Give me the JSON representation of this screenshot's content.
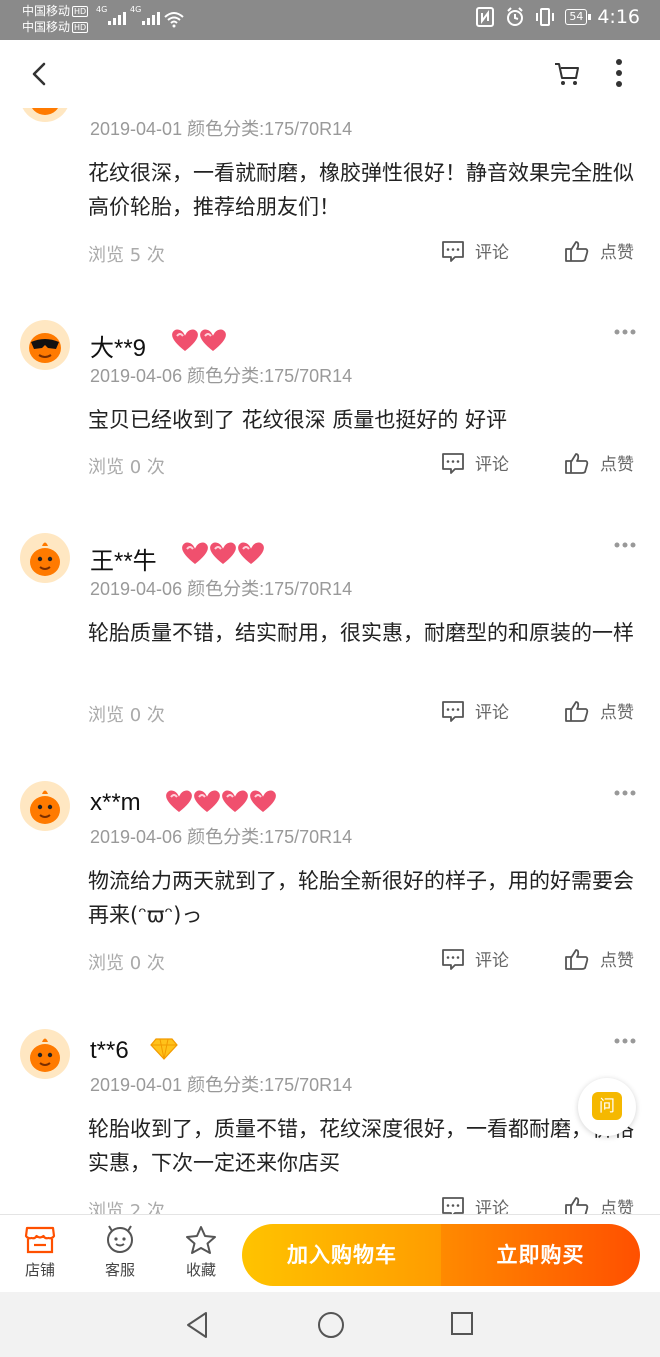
{
  "status_bar": {
    "carrier_1": "中国移动",
    "carrier_2": "中国移动",
    "hd": "HD",
    "network": "4G",
    "battery": "54",
    "time": "4:16"
  },
  "nav": {
    "back_icon": "chevron-left-icon",
    "cart_icon": "cart-icon",
    "more_icon": "more-vertical-icon"
  },
  "reviews": [
    {
      "user": "",
      "date": "2019-04-01",
      "sku": "颜色分类:175/70R14",
      "content": "花纹很深，一看就耐磨，橡胶弹性很好！静音效果完全胜似高价轮胎，推荐给朋友们！",
      "views": "浏览 5 次",
      "comment_label": "评论",
      "like_label": "点赞"
    },
    {
      "user": "大**9",
      "hearts": 2,
      "date": "2019-04-06",
      "sku": "颜色分类:175/70R14",
      "content": "宝贝已经收到了  花纹很深 质量也挺好的 好评",
      "views": "浏览 0 次",
      "comment_label": "评论",
      "like_label": "点赞"
    },
    {
      "user": "王**牛",
      "hearts": 3,
      "date": "2019-04-06",
      "sku": "颜色分类:175/70R14",
      "content": "轮胎质量不错，结实耐用，很实惠，耐磨型的和原装的一样",
      "views": "浏览 0 次",
      "comment_label": "评论",
      "like_label": "点赞"
    },
    {
      "user": "x**m",
      "hearts": 4,
      "date": "2019-04-06",
      "sku": "颜色分类:175/70R14",
      "content": "物流给力两天就到了，轮胎全新很好的样子，用的好需要会再来(ᵔϖᵔ)っ",
      "views": "浏览 0 次",
      "comment_label": "评论",
      "like_label": "点赞"
    },
    {
      "user": "t**6",
      "badge": "diamond",
      "date": "2019-04-01",
      "sku": "颜色分类:175/70R14",
      "content": "轮胎收到了，质量不错，花纹深度很好，一看都耐磨，价格实惠，下次一定还来你店买",
      "views": "浏览 2 次",
      "comment_label": "评论",
      "like_label": "点赞"
    }
  ],
  "ask_button": "问",
  "bottom_bar": {
    "shop_label": "店铺",
    "service_label": "客服",
    "favorite_label": "收藏",
    "add_to_cart": "加入购物车",
    "buy_now": "立即购买"
  },
  "colors": {
    "accent_orange": "#ff5000",
    "accent_yellow": "#ffc300",
    "status_bar": "#8a8a8a",
    "heart": "#f0506e"
  }
}
